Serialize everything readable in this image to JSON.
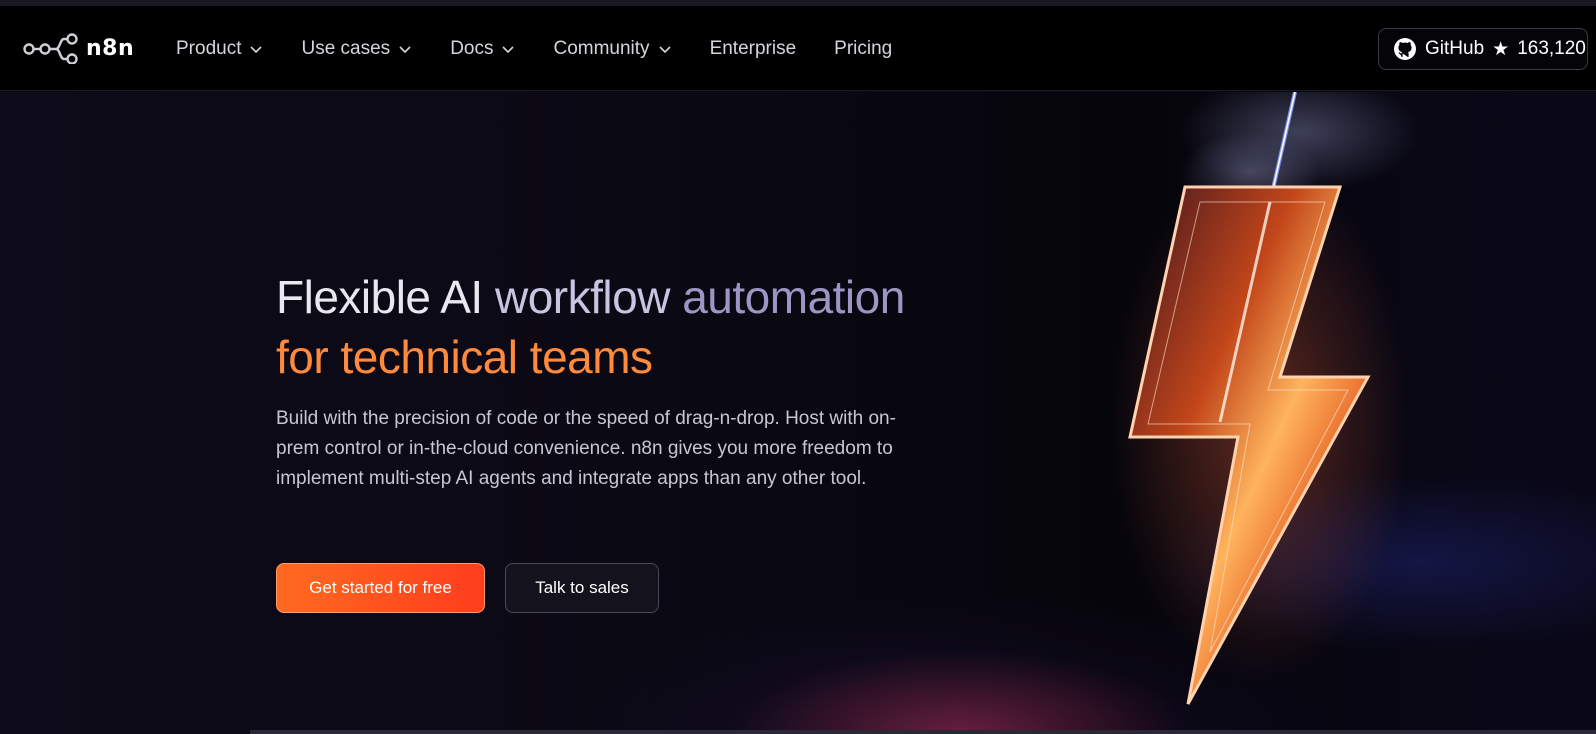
{
  "nav": {
    "logo_text": "n8n",
    "items": [
      {
        "label": "Product",
        "dropdown": true
      },
      {
        "label": "Use cases",
        "dropdown": true
      },
      {
        "label": "Docs",
        "dropdown": true
      },
      {
        "label": "Community",
        "dropdown": true
      },
      {
        "label": "Enterprise",
        "dropdown": false
      },
      {
        "label": "Pricing",
        "dropdown": false
      }
    ],
    "github": {
      "label": "GitHub",
      "star": "★",
      "count": "163,120"
    }
  },
  "hero": {
    "title_part1": "Flexible AI ",
    "title_part2": "workflow ",
    "title_part3": "automation",
    "title_line2": "for technical teams",
    "subtitle": "Build with the precision of code or the speed of drag-n-drop. Host with on-prem control or in-the-cloud convenience. n8n gives you more freedom to implement multi-step AI agents and integrate apps than any other tool.",
    "cta_primary": "Get started for free",
    "cta_secondary": "Talk to sales"
  },
  "colors": {
    "accent_orange": "#ff6a1f",
    "background": "#0a0810",
    "nav_background": "#000000"
  },
  "icons": {
    "logo": "n8n-logo-icon",
    "dropdown": "chevron-down-icon",
    "github": "github-icon",
    "hero_visual": "lightning-bolt-icon"
  }
}
